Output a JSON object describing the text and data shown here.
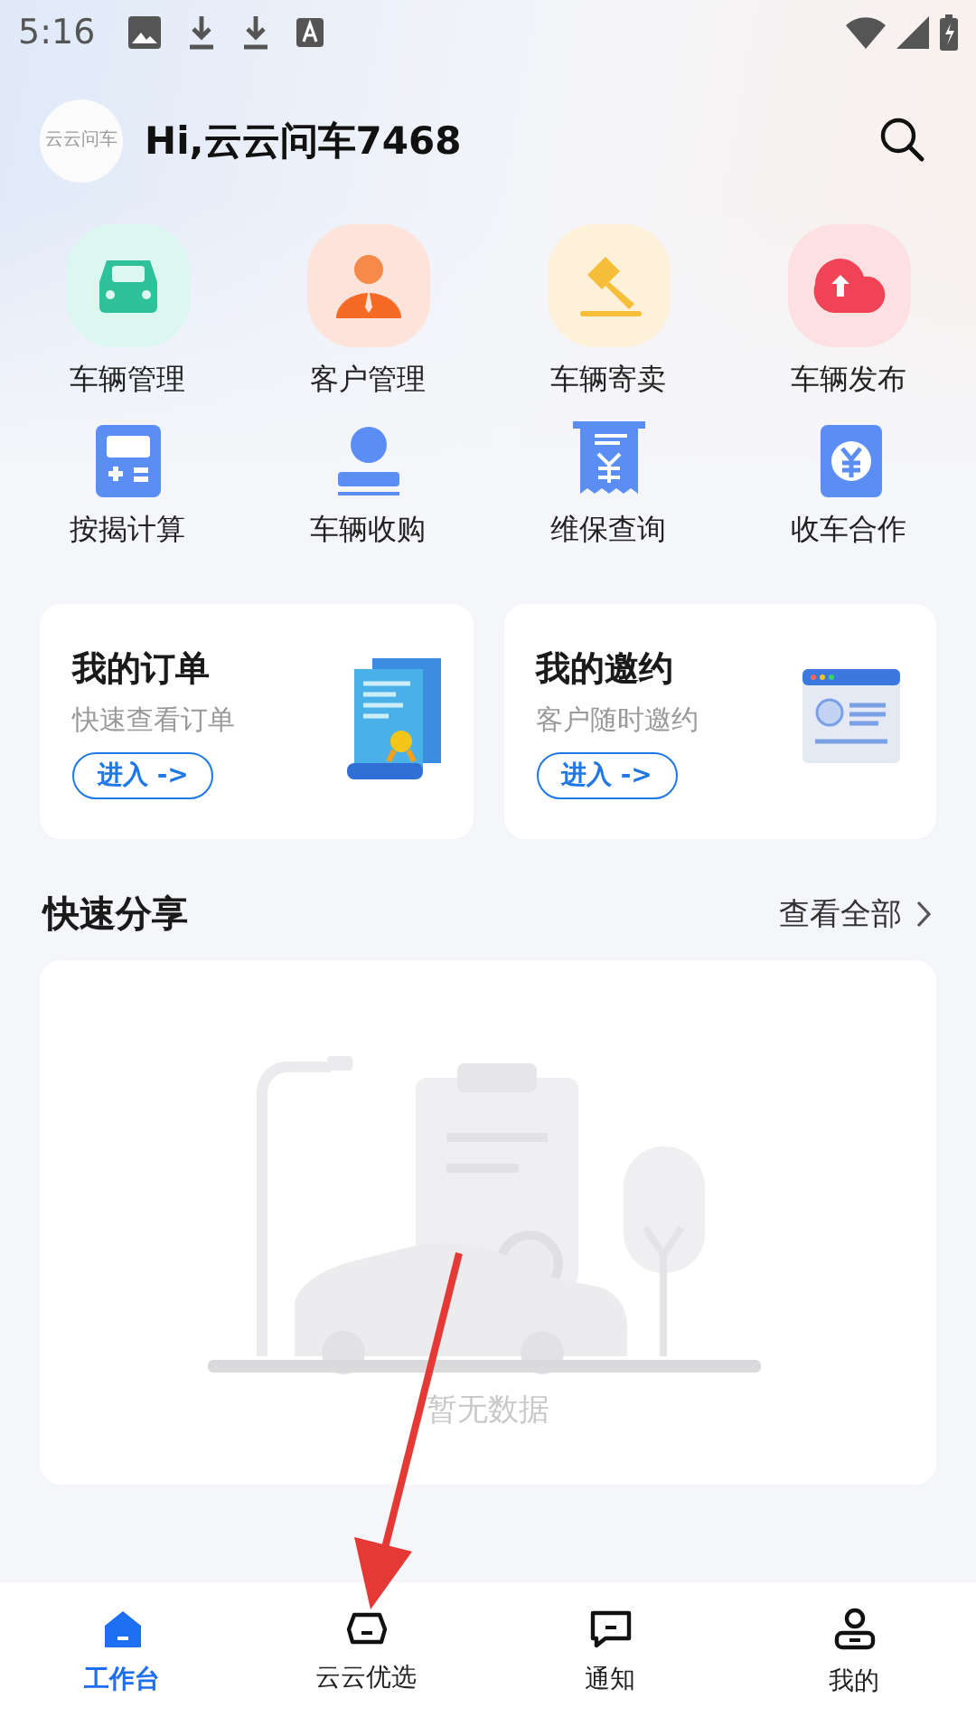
{
  "status_bar": {
    "time": "5:16"
  },
  "header": {
    "avatar_text": "云云问车",
    "greeting": "Hi,云云问车7468"
  },
  "shortcuts": [
    {
      "label": "车辆管理",
      "kind": "car"
    },
    {
      "label": "客户管理",
      "kind": "person"
    },
    {
      "label": "车辆寄卖",
      "kind": "gavel"
    },
    {
      "label": "车辆发布",
      "kind": "upload"
    },
    {
      "label": "按揭计算",
      "kind": "calculator"
    },
    {
      "label": "车辆收购",
      "kind": "stamp"
    },
    {
      "label": "维保查询",
      "kind": "receipt"
    },
    {
      "label": "收车合作",
      "kind": "yen"
    }
  ],
  "cards": [
    {
      "title": "我的订单",
      "subtitle": "快速查看订单",
      "button": "进入 ->",
      "kind": "document"
    },
    {
      "title": "我的邀约",
      "subtitle": "客户随时邀约",
      "button": "进入 ->",
      "kind": "window"
    }
  ],
  "quick_share": {
    "title": "快速分享",
    "more": "查看全部",
    "empty_text": "暂无数据"
  },
  "bottom_nav": [
    {
      "label": "工作台",
      "kind": "home",
      "selected": true
    },
    {
      "label": "云云优选",
      "kind": "car",
      "selected": false
    },
    {
      "label": "通知",
      "kind": "message",
      "selected": false
    },
    {
      "label": "我的",
      "kind": "person",
      "selected": false
    }
  ]
}
